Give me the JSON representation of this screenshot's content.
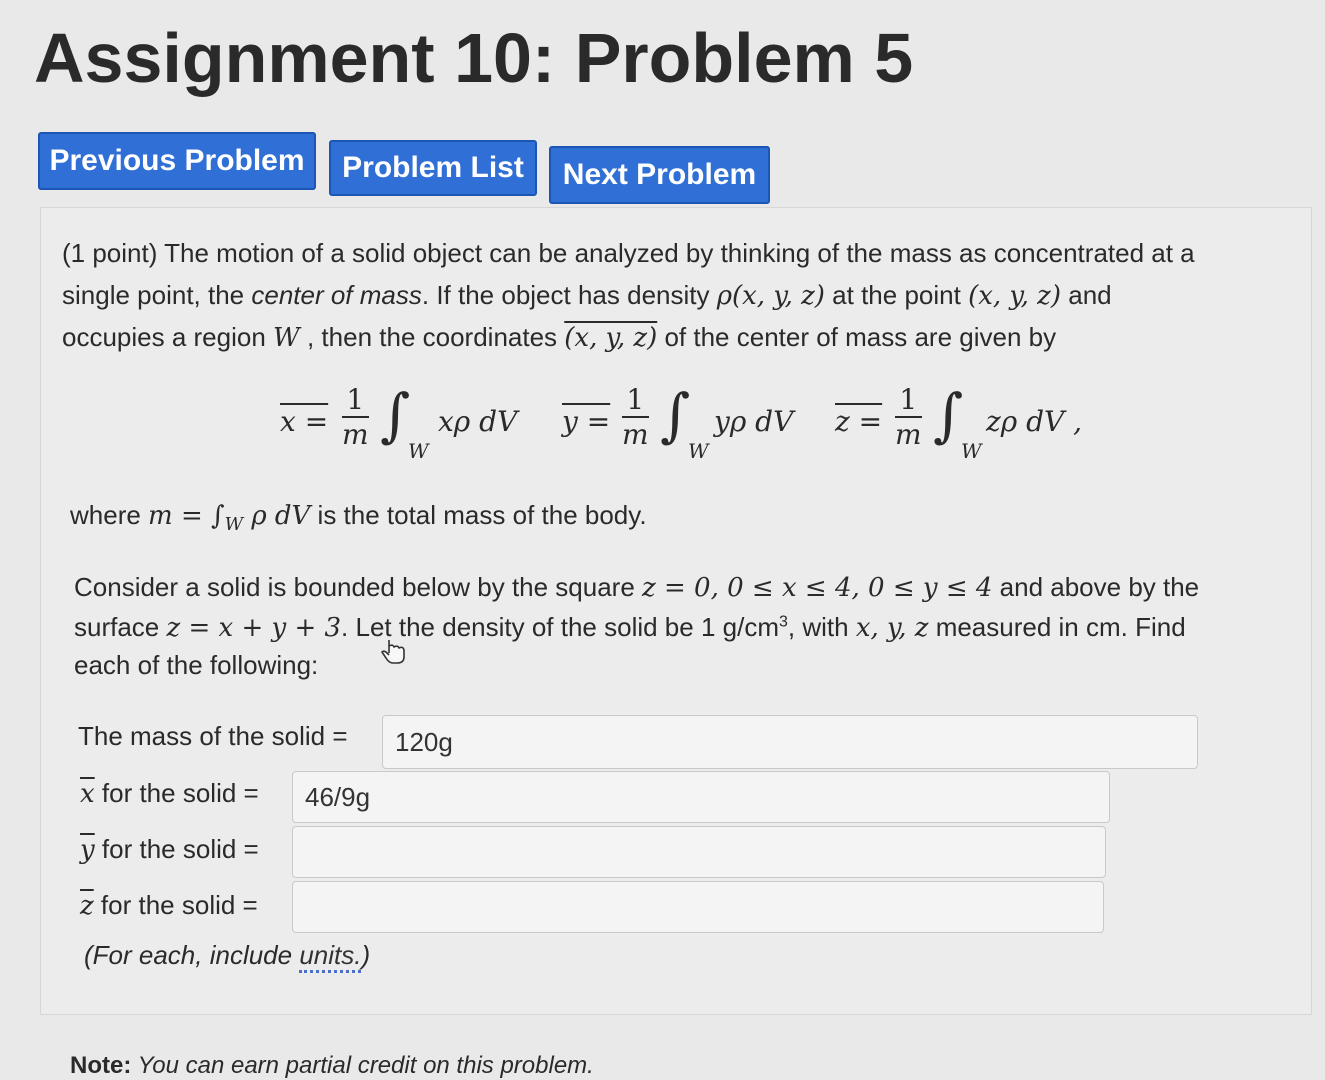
{
  "page": {
    "title": "Assignment 10: Problem 5"
  },
  "nav": {
    "previous": "Previous Problem",
    "list": "Problem List",
    "next": "Next Problem"
  },
  "problem": {
    "line1": "(1 point) The motion of a solid object can be analyzed by thinking of the mass as concentrated at a",
    "line2_a": "single point, the ",
    "line2_em": "center of mass",
    "line2_b": ". If the object has density ",
    "line2_math1": "ρ(x, y, z)",
    "line2_c": " at the point ",
    "line2_math2": "(x, y, z)",
    "line2_d": " and",
    "line3_a": "occupies a region ",
    "line3_math1": "W",
    "line3_b": " , then the coordinates ",
    "line3_math2": "(x, y, z)",
    "line3_c": " of the center of mass are given by",
    "formulas": {
      "x_lhs": "x =",
      "y_lhs": "y =",
      "z_lhs": "z =",
      "frac_num": "1",
      "frac_den": "m",
      "integral": "∫",
      "region": "W",
      "x_integrand": "xρ dV",
      "y_integrand": "yρ dV",
      "z_integrand": "zρ dV ,"
    },
    "where_a": "where ",
    "where_math": "m = ∫",
    "where_sub": "W",
    "where_math2": " ρ dV",
    "where_b": " is the total mass of the body.",
    "consider1_a": "Consider a solid is bounded below by the square ",
    "consider1_math": "z = 0, 0 ≤ x ≤ 4, 0 ≤ y ≤ 4",
    "consider1_b": " and above by the",
    "consider2_a": "surface ",
    "consider2_math": "z = x + y + 3",
    "consider2_b": ". Let the density of the solid be 1 g/cm",
    "consider2_sup": "3",
    "consider2_c": ", with ",
    "consider2_math2": "x, y, z",
    "consider2_d": " measured in cm. Find",
    "consider3": "each of the following:"
  },
  "answers": {
    "mass_label": "The mass of the solid =",
    "mass_value": "120g",
    "x_label_var": "x",
    "x_label_rest": " for the solid =",
    "x_value": "46/9g",
    "y_label_var": "y",
    "y_label_rest": " for the solid =",
    "y_value": "",
    "z_label_var": "z",
    "z_label_rest": " for the solid =",
    "z_value": "",
    "units_note_a": "(For each, include ",
    "units_note_link": "units.",
    "units_note_b": ")"
  },
  "note": {
    "bold": "Note:",
    "text": " You can earn partial credit on this problem."
  },
  "icons": {
    "cursor": "hand-pointer-icon"
  }
}
